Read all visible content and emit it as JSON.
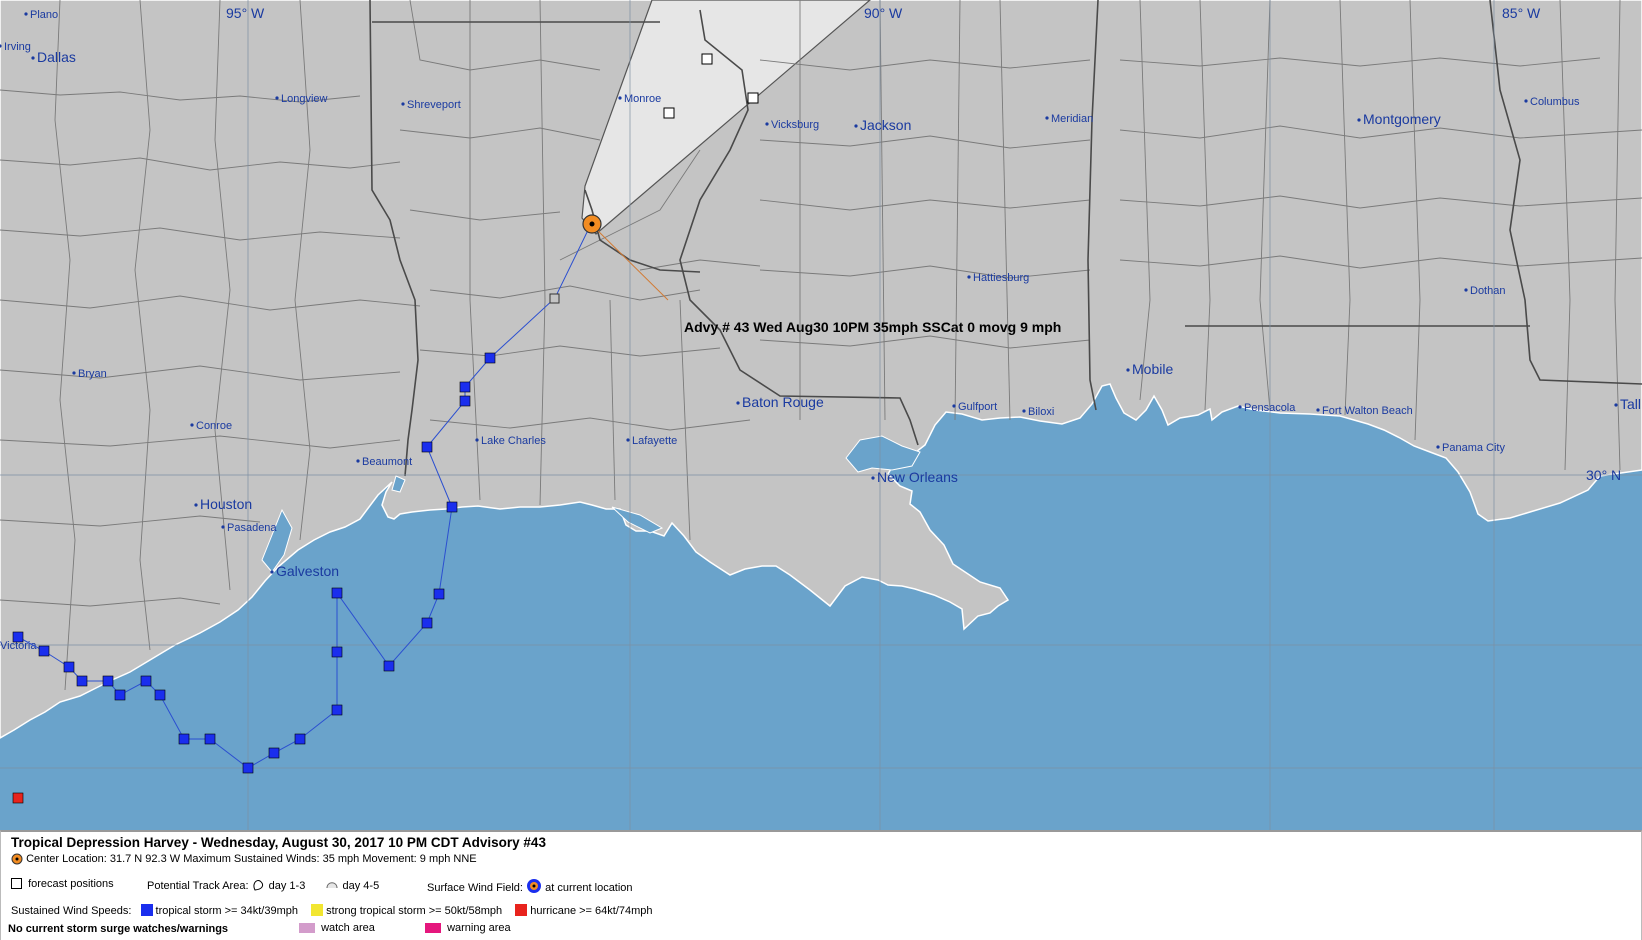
{
  "longitude_labels": [
    "95° W",
    "90° W",
    "85° W"
  ],
  "latitude_labels": [
    "30° N"
  ],
  "cities": [
    {
      "name": "Plano",
      "size": "small"
    },
    {
      "name": "Irving",
      "size": "small"
    },
    {
      "name": "Dallas",
      "size": "big"
    },
    {
      "name": "Longview",
      "size": "small"
    },
    {
      "name": "Shreveport",
      "size": "small"
    },
    {
      "name": "Monroe",
      "size": "small"
    },
    {
      "name": "Vicksburg",
      "size": "small"
    },
    {
      "name": "Jackson",
      "size": "big"
    },
    {
      "name": "Meridian",
      "size": "small"
    },
    {
      "name": "Montgomery",
      "size": "big"
    },
    {
      "name": "Columbus",
      "size": "small"
    },
    {
      "name": "Hattiesburg",
      "size": "small"
    },
    {
      "name": "Dothan",
      "size": "small"
    },
    {
      "name": "Bryan",
      "size": "small"
    },
    {
      "name": "Conroe",
      "size": "small"
    },
    {
      "name": "Beaumont",
      "size": "small"
    },
    {
      "name": "Lake Charles",
      "size": "small"
    },
    {
      "name": "Lafayette",
      "size": "small"
    },
    {
      "name": "Baton Rouge",
      "size": "big"
    },
    {
      "name": "Gulfport",
      "size": "small"
    },
    {
      "name": "Biloxi",
      "size": "small"
    },
    {
      "name": "Mobile",
      "size": "big"
    },
    {
      "name": "Pensacola",
      "size": "small"
    },
    {
      "name": "Fort Walton Beach",
      "size": "small"
    },
    {
      "name": "Panama City",
      "size": "small"
    },
    {
      "name": "New Orleans",
      "size": "big"
    },
    {
      "name": "Houston",
      "size": "big"
    },
    {
      "name": "Pasadena",
      "size": "small"
    },
    {
      "name": "Galveston",
      "size": "big"
    },
    {
      "name": "Victoria",
      "size": "small"
    },
    {
      "name": "Tall",
      "size": "big"
    }
  ],
  "advisory_label": "Advy # 43 Wed Aug30 10PM  35mph SSCat 0 movg 9 mph",
  "storm": {
    "center_lat": 31.7,
    "center_lon": -92.3,
    "max_winds_mph": 35,
    "movement": "9 mph NNE"
  },
  "legend": {
    "title": "Tropical Depression Harvey  -  Wednesday, August 30, 2017  10 PM CDT   Advisory #43",
    "center_line": "Center Location: 31.7 N  92.3 W   Maximum Sustained Winds: 35 mph  Movement: 9 mph NNE",
    "forecast_positions": "forecast positions",
    "potential_track_area": "Potential Track Area:",
    "day13": "day 1-3",
    "day45": "day 4-5",
    "surface_wind_field": "Surface Wind Field:",
    "at_current_location": "at current location",
    "sustained_wind_speeds": "Sustained Wind Speeds:",
    "ts": "tropical storm >= 34kt/39mph",
    "sts": "strong tropical storm >= 50kt/58mph",
    "hu": "hurricane >= 64kt/74mph",
    "no_surge": "No current storm surge watches/warnings",
    "watch_area": "watch area",
    "warning_area": "warning area"
  },
  "colors": {
    "water": "#6aa3cb",
    "land": "#c4c4c4",
    "cone": "#e6e6e6",
    "tropical_storm": "#1a2eee",
    "strong_tropical_storm": "#f2e631",
    "hurricane": "#e8231d",
    "watch": "#d39ccb",
    "warning": "#e5177d",
    "center": "#f28c22"
  }
}
